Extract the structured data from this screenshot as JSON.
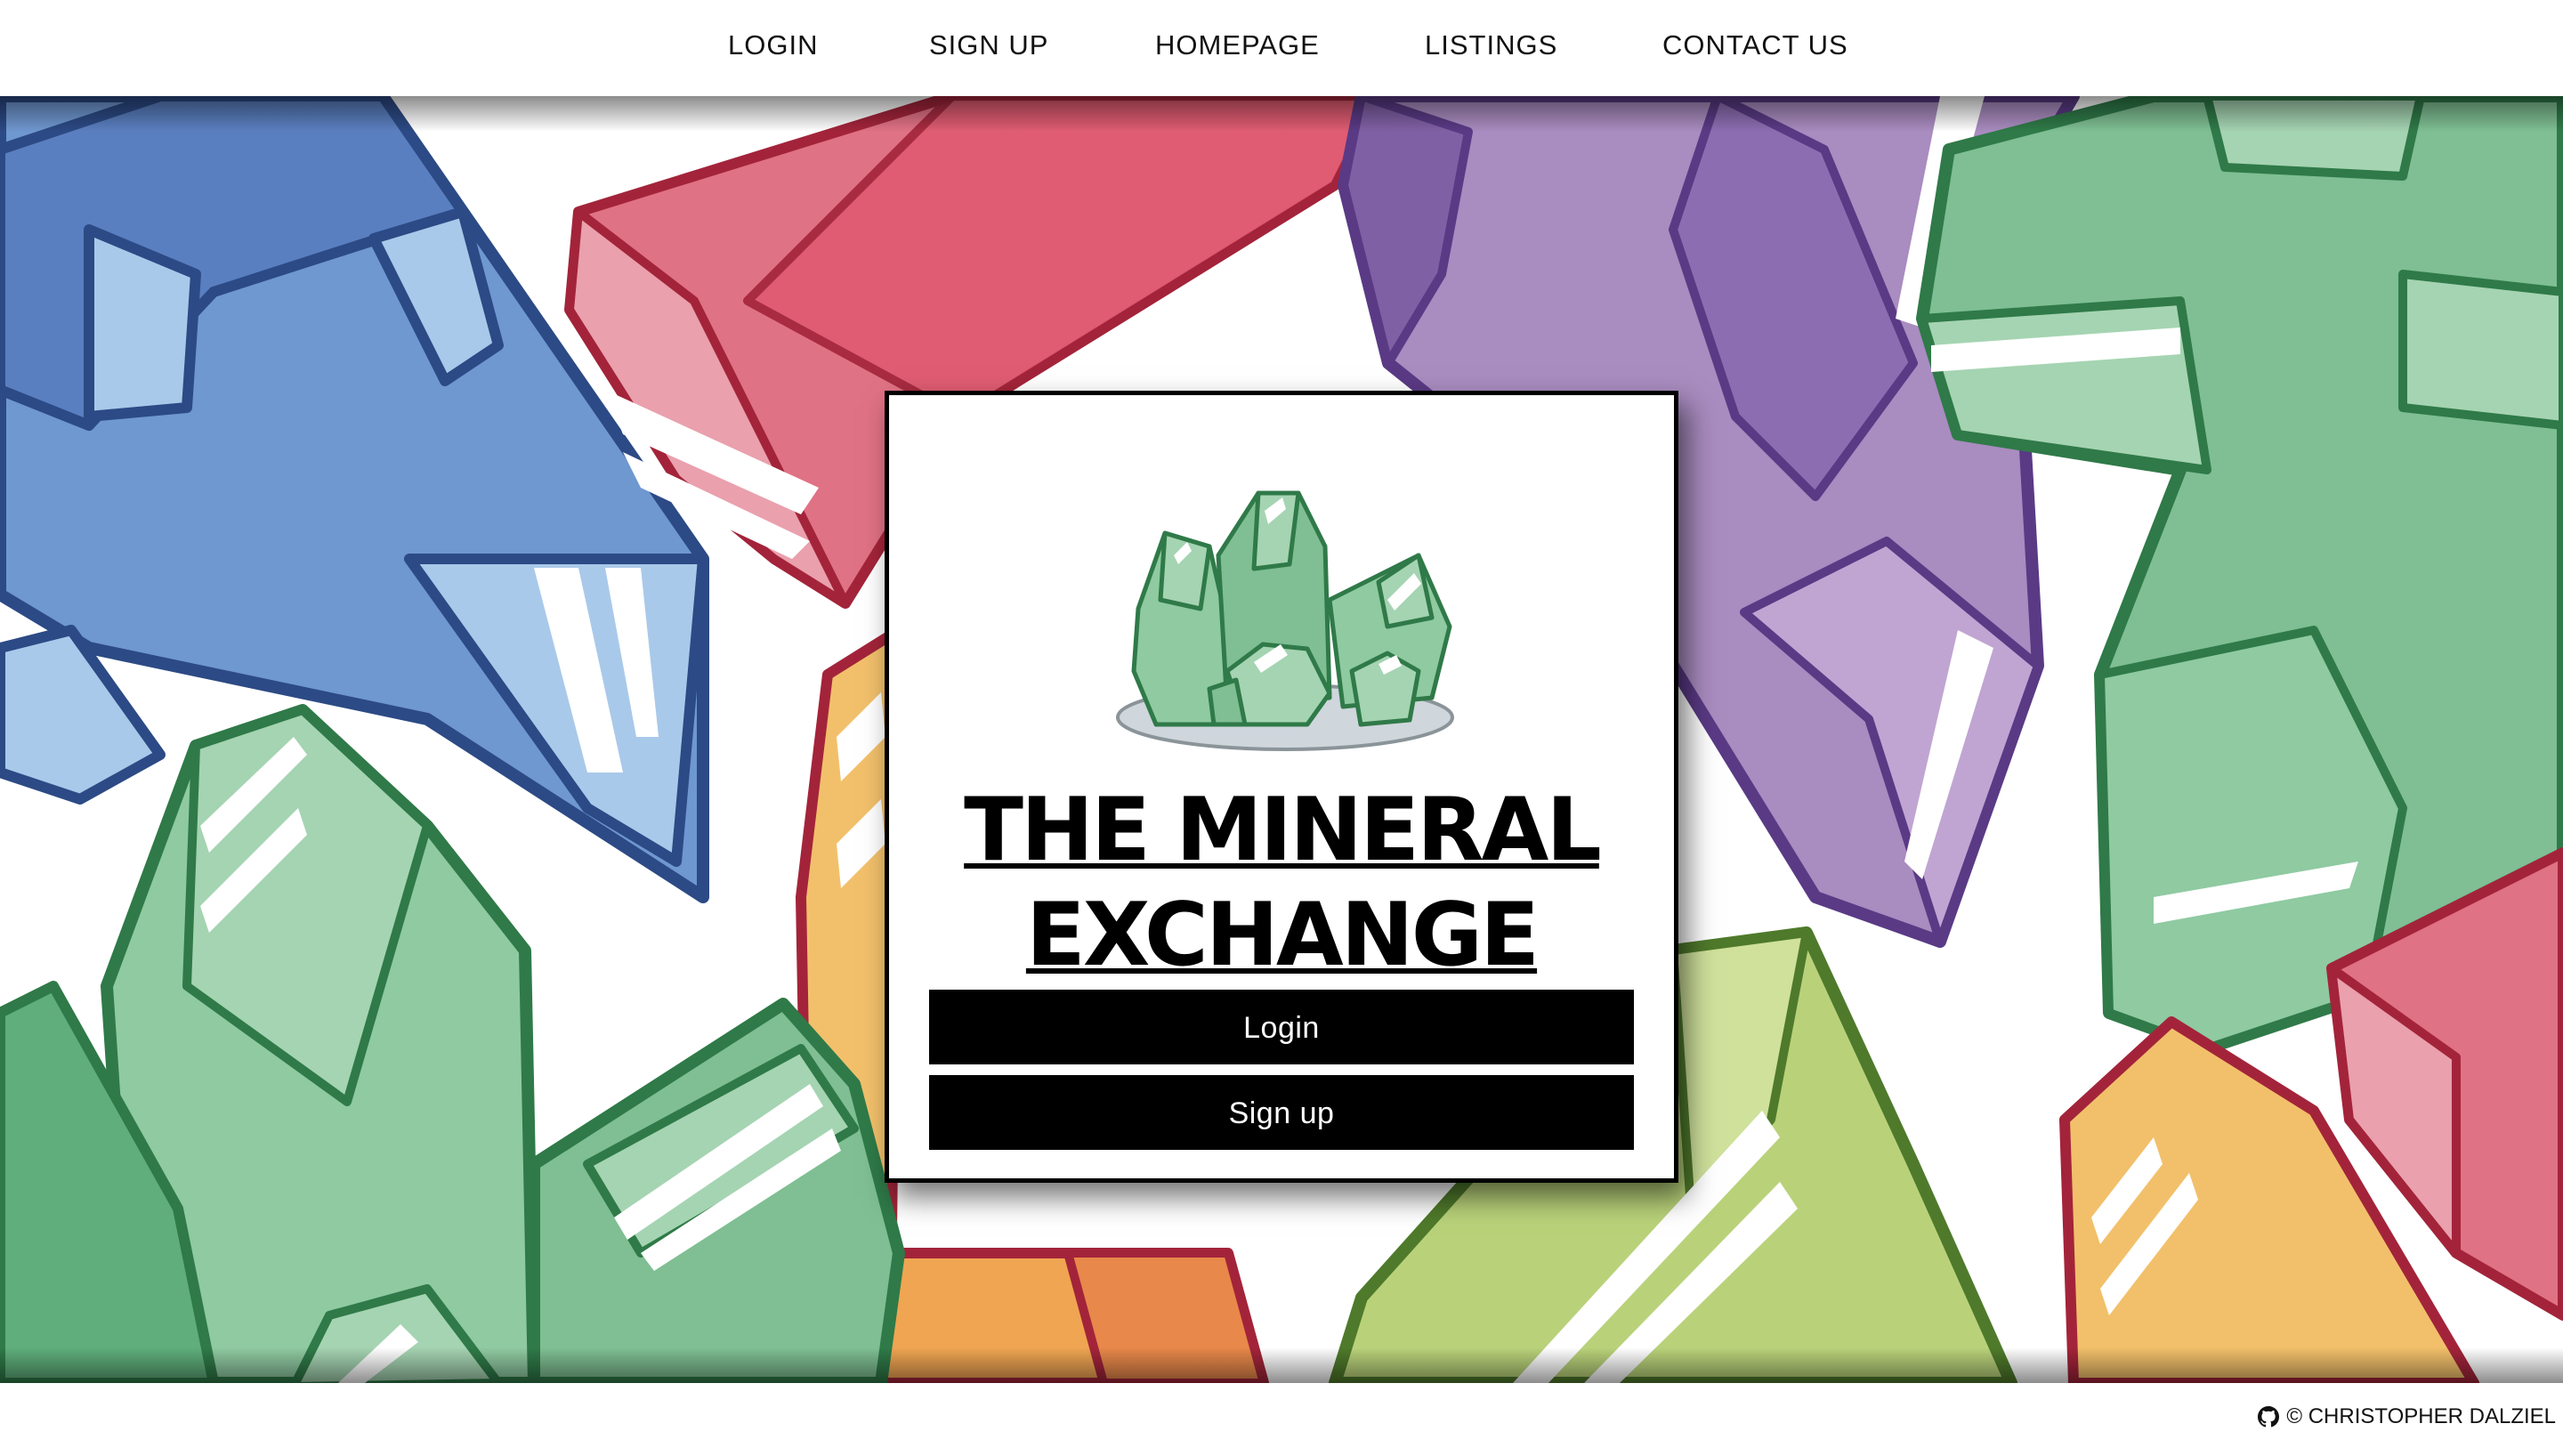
{
  "nav": {
    "items": [
      {
        "label": "LOGIN"
      },
      {
        "label": "SIGN UP"
      },
      {
        "label": "HOMEPAGE"
      },
      {
        "label": "LISTINGS"
      },
      {
        "label": "CONTACT US"
      }
    ]
  },
  "card": {
    "title_line1": "THE MINERAL",
    "title_line2": "EXCHANGE",
    "login_label": "Login",
    "signup_label": "Sign up",
    "logo_icon": "green-crystal-cluster-icon"
  },
  "footer": {
    "credit": "© CHRISTOPHER DALZIEL",
    "icon": "github-icon"
  },
  "colors": {
    "accent": "#000000",
    "background": "#ffffff",
    "crystal_blue": "#7aa3d8",
    "crystal_red": "#e26a7e",
    "crystal_purple": "#a98cc0",
    "crystal_green": "#7fbf93",
    "crystal_yellow": "#f2c06b",
    "crystal_lime": "#b9d27a"
  }
}
